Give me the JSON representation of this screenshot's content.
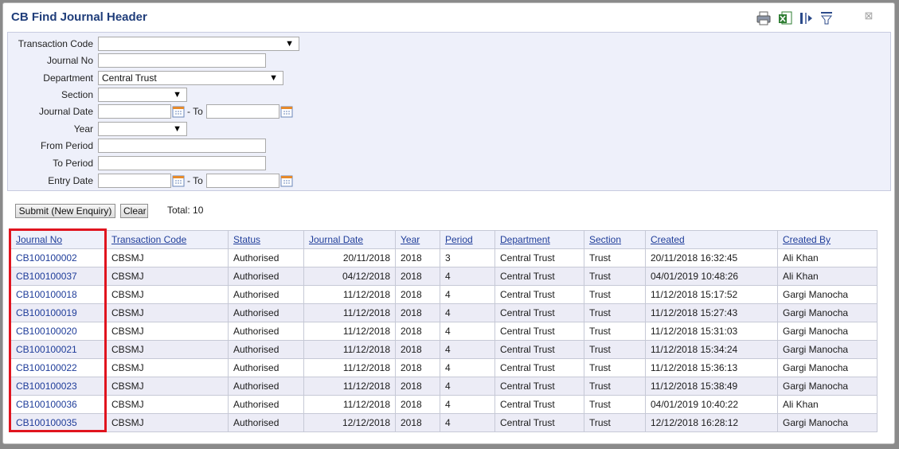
{
  "window": {
    "title": "CB Find Journal Header",
    "close_label": "⊠"
  },
  "toolbar": {
    "icons": [
      "print-icon",
      "excel-export-icon",
      "column-chooser-icon",
      "filter-icon"
    ]
  },
  "form": {
    "transaction_code": {
      "label": "Transaction Code",
      "value": ""
    },
    "journal_no": {
      "label": "Journal No",
      "value": ""
    },
    "department": {
      "label": "Department",
      "value": "Central Trust"
    },
    "section": {
      "label": "Section",
      "value": ""
    },
    "journal_date": {
      "label": "Journal Date",
      "value": "",
      "to_label": "- To",
      "to_value": ""
    },
    "year": {
      "label": "Year",
      "value": ""
    },
    "from_period": {
      "label": "From Period",
      "value": ""
    },
    "to_period": {
      "label": "To Period",
      "value": ""
    },
    "entry_date": {
      "label": "Entry Date",
      "value": "",
      "to_label": "- To",
      "to_value": ""
    }
  },
  "actions": {
    "submit_label": "Submit (New Enquiry)",
    "clear_label": "Clear",
    "total_label": "Total: 10"
  },
  "table": {
    "columns": [
      "Journal No",
      "Transaction Code",
      "Status",
      "Journal Date",
      "Year",
      "Period",
      "Department",
      "Section",
      "Created",
      "Created By"
    ],
    "rows": [
      [
        "CB100100002",
        "CBSMJ",
        "Authorised",
        "20/11/2018",
        "2018",
        "3",
        "Central Trust",
        "Trust",
        "20/11/2018 16:32:45",
        "Ali Khan"
      ],
      [
        "CB100100037",
        "CBSMJ",
        "Authorised",
        "04/12/2018",
        "2018",
        "4",
        "Central Trust",
        "Trust",
        "04/01/2019 10:48:26",
        "Ali Khan"
      ],
      [
        "CB100100018",
        "CBSMJ",
        "Authorised",
        "11/12/2018",
        "2018",
        "4",
        "Central Trust",
        "Trust",
        "11/12/2018 15:17:52",
        "Gargi Manocha"
      ],
      [
        "CB100100019",
        "CBSMJ",
        "Authorised",
        "11/12/2018",
        "2018",
        "4",
        "Central Trust",
        "Trust",
        "11/12/2018 15:27:43",
        "Gargi Manocha"
      ],
      [
        "CB100100020",
        "CBSMJ",
        "Authorised",
        "11/12/2018",
        "2018",
        "4",
        "Central Trust",
        "Trust",
        "11/12/2018 15:31:03",
        "Gargi Manocha"
      ],
      [
        "CB100100021",
        "CBSMJ",
        "Authorised",
        "11/12/2018",
        "2018",
        "4",
        "Central Trust",
        "Trust",
        "11/12/2018 15:34:24",
        "Gargi Manocha"
      ],
      [
        "CB100100022",
        "CBSMJ",
        "Authorised",
        "11/12/2018",
        "2018",
        "4",
        "Central Trust",
        "Trust",
        "11/12/2018 15:36:13",
        "Gargi Manocha"
      ],
      [
        "CB100100023",
        "CBSMJ",
        "Authorised",
        "11/12/2018",
        "2018",
        "4",
        "Central Trust",
        "Trust",
        "11/12/2018 15:38:49",
        "Gargi Manocha"
      ],
      [
        "CB100100036",
        "CBSMJ",
        "Authorised",
        "11/12/2018",
        "2018",
        "4",
        "Central Trust",
        "Trust",
        "04/01/2019 10:40:22",
        "Ali Khan"
      ],
      [
        "CB100100035",
        "CBSMJ",
        "Authorised",
        "12/12/2018",
        "2018",
        "4",
        "Central Trust",
        "Trust",
        "12/12/2018 16:28:12",
        "Gargi Manocha"
      ]
    ]
  },
  "colors": {
    "title": "#1f3d7a",
    "link": "#1f3d9a",
    "panel_bg": "#eef0fa",
    "highlight": "#e0141e"
  }
}
